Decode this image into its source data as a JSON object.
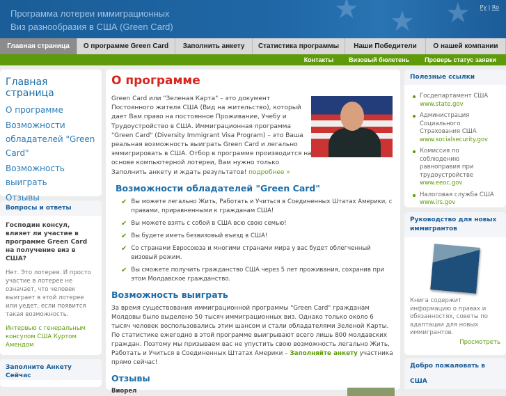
{
  "header": {
    "title_line1": "Программа лотереи иммиграционных",
    "title_line2": "Виз разнообразия в США (Green Card)",
    "lang_ru": "Ру",
    "lang_sep": "|",
    "lang_ro": "Ro"
  },
  "nav": [
    {
      "label": "Главная страница",
      "active": true
    },
    {
      "label": "О программе Green Card"
    },
    {
      "label": "Заполнить анкету"
    },
    {
      "label": "Статистика программы"
    },
    {
      "label": "Наши Победители"
    },
    {
      "label": "О нашей компании"
    }
  ],
  "subnav": [
    "Контакты",
    "Визовый бюлетень",
    "Проверь статус заявки"
  ],
  "left": {
    "heading": "Главная страница",
    "items": [
      "О программе",
      "Возможности обладателей \"Green Card\"",
      "Возможность выиграть",
      "Отзывы"
    ],
    "qa_title": "Вопросы и ответы",
    "qa_question": "Господин консул, влияет ли участие в программе Green Card на получение виз в США?",
    "qa_answer": "Нет. Это лотерея. И просто участие в лотерее не означает, что человек выиграет в этой лотерее или уедет, если появится такая возможность.",
    "qa_link": "Интервью с генеральным консулом США Куртом Амендом",
    "fill_title": "Заполните Анкету Сейчас"
  },
  "main": {
    "title": "О программе",
    "intro": "Green Card или \"Зеленая Карта\" – это документ Постоянного жителя США (Вид на жительство), который дает Вам право на постоянное Проживание, Учебу и Трудоустройство в США. Иммиграционная программа \"Green Card\" (Diversity Immigrant Visa Program) – это Ваша реальная возможность выиграть Green Card и легально эммигрировать в США. Отбор в программе производится на основе компьютерной лотереи, Вам нужно только Заполнить анкету и ждать результатов!",
    "more": "подробнее »",
    "benefits_title": "Возможности обладателей \"Green Card\"",
    "benefits": [
      "Вы можете легально Жить, Работать и Учиться в Соединенных Штатах Америки, с правами, приравненными к гражданам США!",
      "Вы можете взять с собой в США всю свою семью!",
      "Вы будете иметь безвизовый въезд в США!",
      "Со странами Евросоюза и многими странами мира у вас будет облегченный визовый режим.",
      "Вы сможете получить гражданство США через 5 лет проживания, сохранив при этом Молдавское гражданство."
    ],
    "win_title": "Возможность выиграть",
    "win_text": "За время существования иммиграционной программы \"Green Card\" гражданам Молдовы было выделено 50 тысяч иммиграционных виз. Однако только около 6 тысяч человек воспользовались этим шансом и стали обладателями Зеленой Карты. По статистике ежегодно в этой программе выигрывают всего лишь 800 молдавских граждан. Поэтому мы призываем вас не упустить свою возможность  легально Жить, Работать и Учиться в Соединенных Штатах Америки –",
    "win_link": "Заполняйте анкету",
    "win_tail": "участника прямо сейчас!",
    "reviews_title": "Отзывы",
    "review_name": "Виорел"
  },
  "right": {
    "links_title": "Полезные ссылки",
    "links": [
      {
        "name": "Госдепартамент США",
        "url": "www.state.gov"
      },
      {
        "name": "Администрация Социального Страхования США",
        "url": "www.socialsecurity.gov"
      },
      {
        "name": "Комиссия по соблюдению равноправия при трудоустройстве",
        "url": "www.eeoc.gov"
      },
      {
        "name": "Налоговая служба США",
        "url": "www.irs.gov"
      }
    ],
    "guide_title": "Руководство для новых иммигрантов",
    "guide_text": "Книга содержит информацию о правах и обязанностях, советы по адаптации для новых иммигрантов.",
    "guide_link": "Просмотреть",
    "welcome_title": "Добро пожаловать в США"
  }
}
